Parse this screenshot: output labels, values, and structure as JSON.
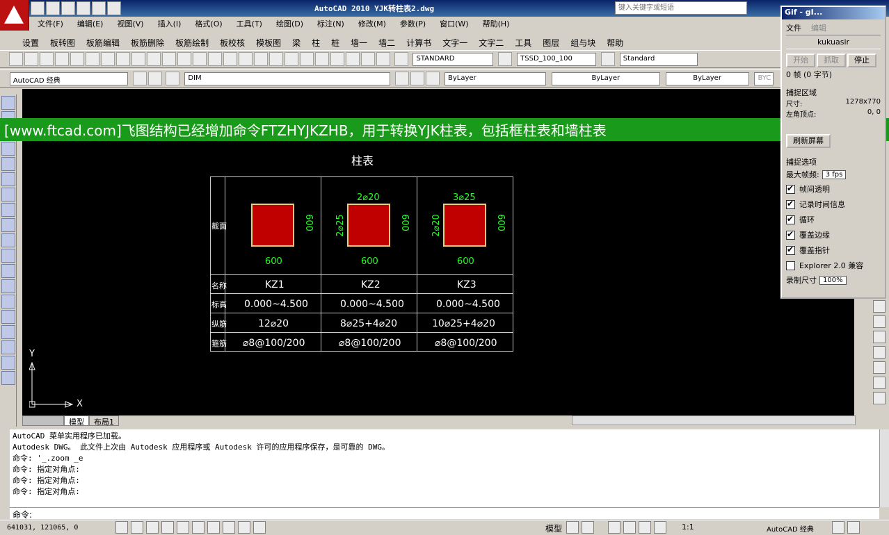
{
  "window": {
    "title": "AutoCAD 2010   YJK转柱表2.dwg"
  },
  "search": {
    "placeholder": "键入关键字或短语"
  },
  "menubar_main": [
    "文件(F)",
    "编辑(E)",
    "视图(V)",
    "插入(I)",
    "格式(O)",
    "工具(T)",
    "绘图(D)",
    "标注(N)",
    "修改(M)",
    "参数(P)",
    "窗口(W)",
    "帮助(H)"
  ],
  "menubar_plugin": [
    "设置",
    "板转图",
    "板筋编辑",
    "板筋删除",
    "板筋绘制",
    "板校核",
    "模板图",
    "梁",
    "柱",
    "桩",
    "墙一",
    "墙二",
    "计算书",
    "文字一",
    "文字二",
    "工具",
    "图层",
    "组与块",
    "帮助"
  ],
  "toolbar1": {
    "text_style": "STANDARD",
    "dim_style": "TSSD_100_100",
    "table_style": "Standard"
  },
  "toolbar2": {
    "workspace": "AutoCAD 经典",
    "layer": "DIM",
    "color": "ByLayer",
    "linetype": "ByLayer",
    "lineweight": "ByLayer",
    "plot": "BYC"
  },
  "banner": "[www.ftcad.com]飞图结构已经增加命令FTZHYJKZHB，用于转换YJK柱表，包括框柱表和墙柱表",
  "drawing": {
    "table_title": "柱表",
    "row_headers": [
      "截面",
      "名称",
      "标高",
      "纵筋",
      "箍筋"
    ],
    "columns": [
      {
        "name": "KZ1",
        "elevation": "0.000~4.500",
        "long_bars": "12⌀20",
        "stirrups": "⌀8@100/200",
        "top_label": "",
        "side_label": "",
        "dim_w": "600",
        "dim_h": "600"
      },
      {
        "name": "KZ2",
        "elevation": "0.000~4.500",
        "long_bars": "8⌀25+4⌀20",
        "stirrups": "⌀8@100/200",
        "top_label": "2⌀20",
        "side_label": "2⌀25",
        "dim_w": "600",
        "dim_h": "600"
      },
      {
        "name": "KZ3",
        "elevation": "0.000~4.500",
        "long_bars": "10⌀25+4⌀20",
        "stirrups": "⌀8@100/200",
        "top_label": "3⌀25",
        "side_label": "2⌀20",
        "dim_w": "600",
        "dim_h": "600"
      }
    ],
    "axis_x": "X",
    "axis_y": "Y"
  },
  "tabs": [
    "模型",
    "布局1"
  ],
  "command_history": [
    "AutoCAD 菜单实用程序已加载。",
    "Autodesk DWG。  此文件上次由 Autodesk 应用程序或 Autodesk 许可的应用程序保存，是可靠的 DWG。",
    "命令: '_.zoom _e",
    "命令: 指定对角点:",
    "命令: 指定对角点:",
    "命令: 指定对角点:"
  ],
  "command_prompt": "命令:",
  "status": {
    "coords": "641031, 121065, 0",
    "model_label": "模型",
    "scale": "1:1",
    "workspace": "AutoCAD 经典"
  },
  "gif_panel": {
    "title": "Gif - gI...",
    "menu": [
      "文件",
      "编辑"
    ],
    "user": "kukuasir",
    "buttons": [
      "开始",
      "抓取",
      "停止"
    ],
    "frames": "0 帧 (0 字节)",
    "capture_header": "捕捉区域",
    "size_label": "尺寸:",
    "size_value": "1278x770",
    "corner_label": "左角顶点:",
    "corner_value": "0, 0",
    "refresh": "刷新屏幕",
    "options_header": "捕捉选项",
    "max_fps_label": "最大帧频:",
    "max_fps_value": "3 fps",
    "options": [
      {
        "label": "帧间透明",
        "checked": true
      },
      {
        "label": "记录时间信息",
        "checked": true
      },
      {
        "label": "循环",
        "checked": true
      },
      {
        "label": "覆盖边缘",
        "checked": true
      },
      {
        "label": "覆盖指针",
        "checked": true
      },
      {
        "label": "Explorer 2.0 兼容",
        "checked": false
      }
    ],
    "rec_size_label": "录制尺寸",
    "rec_size_value": "100%"
  },
  "colors": {
    "banner": "#1a9a1a",
    "column_section": "#c00000",
    "dimension": "#22ff22"
  }
}
